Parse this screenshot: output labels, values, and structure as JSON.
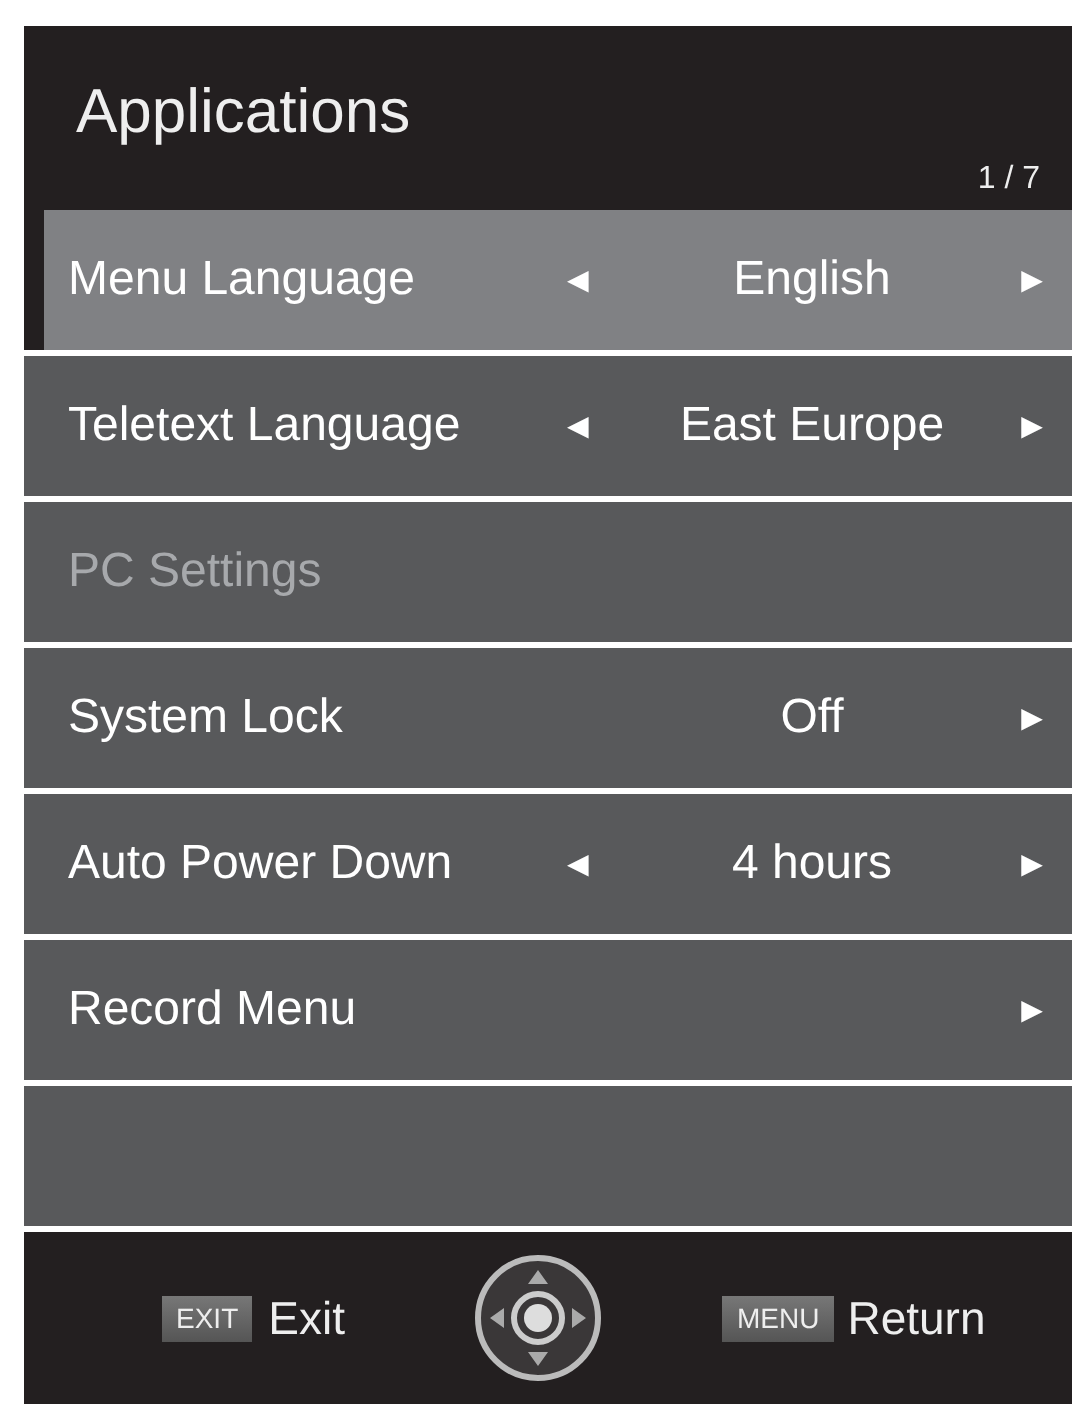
{
  "header": {
    "title": "Applications",
    "page": "1 / 7"
  },
  "rows": [
    {
      "kind": "item",
      "label": "Menu Language",
      "left_arrow": "◄",
      "value": "English",
      "right_arrow": "►",
      "selected": true,
      "disabled": false
    },
    {
      "kind": "item",
      "label": "Teletext Language",
      "left_arrow": "◄",
      "value": "East Europe",
      "right_arrow": "►",
      "selected": false,
      "disabled": false
    },
    {
      "kind": "item",
      "label": "PC Settings",
      "selected": false,
      "disabled": true
    },
    {
      "kind": "item",
      "label": "System Lock",
      "value": "Off",
      "right_arrow": "►",
      "selected": false,
      "disabled": false
    },
    {
      "kind": "item",
      "label": "Auto Power Down",
      "left_arrow": "◄",
      "value": "4 hours",
      "right_arrow": "►",
      "selected": false,
      "disabled": false
    },
    {
      "kind": "item",
      "label": "Record Menu",
      "right_arrow": "►",
      "selected": false,
      "disabled": false
    },
    {
      "kind": "empty"
    }
  ],
  "footer": {
    "exit_key": "EXIT",
    "exit_label": "Exit",
    "menu_key": "MENU",
    "menu_label": "Return"
  }
}
